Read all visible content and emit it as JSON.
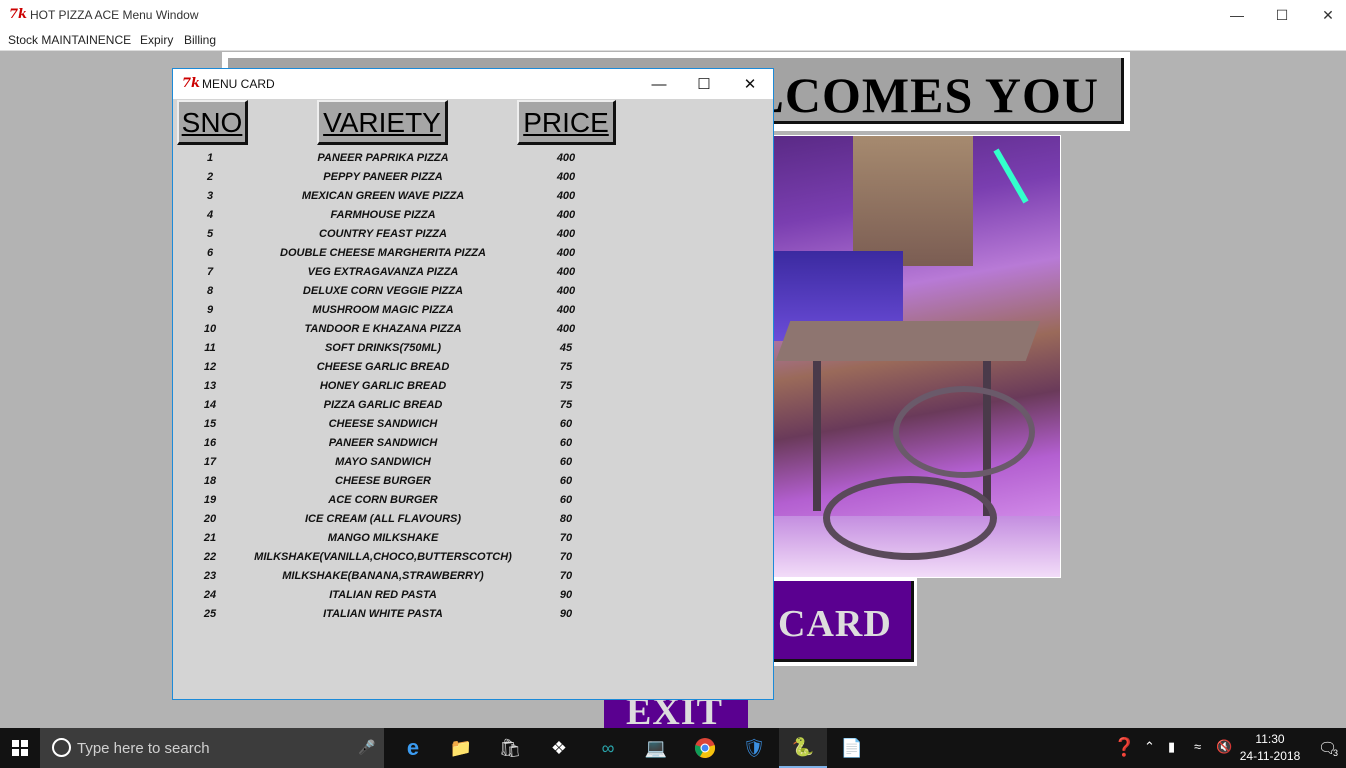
{
  "main_window": {
    "title": "HOT PIZZA ACE Menu Window",
    "menus": [
      "Stock MAINTAINENCE",
      "Expiry",
      "Billing"
    ],
    "welcome_text": "LCOMES YOU",
    "card_button": "CARD",
    "exit_button": "EXIT"
  },
  "dialog": {
    "title": "MENU CARD",
    "headers": {
      "sno": "SNO",
      "variety": "VARIETY",
      "price": "PRICE"
    },
    "rows": [
      {
        "sno": "1",
        "variety": "PANEER PAPRIKA PIZZA",
        "price": "400"
      },
      {
        "sno": "2",
        "variety": "PEPPY PANEER PIZZA",
        "price": "400"
      },
      {
        "sno": "3",
        "variety": "MEXICAN GREEN WAVE PIZZA",
        "price": "400"
      },
      {
        "sno": "4",
        "variety": "FARMHOUSE PIZZA",
        "price": "400"
      },
      {
        "sno": "5",
        "variety": "COUNTRY FEAST PIZZA",
        "price": "400"
      },
      {
        "sno": "6",
        "variety": "DOUBLE CHEESE MARGHERITA PIZZA",
        "price": "400"
      },
      {
        "sno": "7",
        "variety": "VEG EXTRAGAVANZA PIZZA",
        "price": "400"
      },
      {
        "sno": "8",
        "variety": "DELUXE CORN VEGGIE PIZZA",
        "price": "400"
      },
      {
        "sno": "9",
        "variety": "MUSHROOM MAGIC PIZZA",
        "price": "400"
      },
      {
        "sno": "10",
        "variety": "TANDOOR E KHAZANA PIZZA",
        "price": "400"
      },
      {
        "sno": "11",
        "variety": "SOFT DRINKS(750ML)",
        "price": "45"
      },
      {
        "sno": "12",
        "variety": "CHEESE GARLIC BREAD",
        "price": "75"
      },
      {
        "sno": "13",
        "variety": "HONEY GARLIC BREAD",
        "price": "75"
      },
      {
        "sno": "14",
        "variety": "PIZZA GARLIC BREAD",
        "price": "75"
      },
      {
        "sno": "15",
        "variety": "CHEESE SANDWICH",
        "price": "60"
      },
      {
        "sno": "16",
        "variety": "PANEER SANDWICH",
        "price": "60"
      },
      {
        "sno": "17",
        "variety": "MAYO SANDWICH",
        "price": "60"
      },
      {
        "sno": "18",
        "variety": "CHEESE BURGER",
        "price": "60"
      },
      {
        "sno": "19",
        "variety": "ACE CORN BURGER",
        "price": "60"
      },
      {
        "sno": "20",
        "variety": "ICE CREAM (ALL FLAVOURS)",
        "price": "80"
      },
      {
        "sno": "21",
        "variety": "MANGO MILKSHAKE",
        "price": "70"
      },
      {
        "sno": "22",
        "variety": "MILKSHAKE(VANILLA,CHOCO,BUTTERSCOTCH)",
        "price": "70"
      },
      {
        "sno": "23",
        "variety": "MILKSHAKE(BANANA,STRAWBERRY)",
        "price": "70"
      },
      {
        "sno": "24",
        "variety": "ITALIAN RED PASTA",
        "price": "90"
      },
      {
        "sno": "25",
        "variety": "ITALIAN WHITE PASTA",
        "price": "90"
      }
    ]
  },
  "taskbar": {
    "search_placeholder": "Type here to search",
    "time": "11:30",
    "date": "24-11-2018",
    "notification_count": "3"
  },
  "colors": {
    "accent_purple": "#5a0090",
    "window_bg": "#b3b3b3",
    "dialog_bg": "#d4d4d4"
  }
}
